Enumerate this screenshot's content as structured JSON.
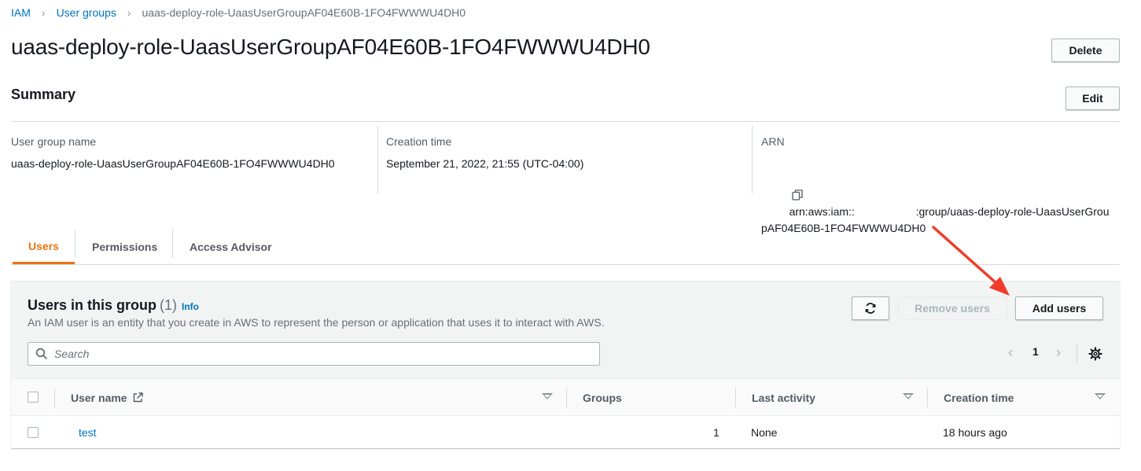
{
  "breadcrumb": {
    "items": [
      "IAM",
      "User groups",
      "uaas-deploy-role-UaasUserGroupAF04E60B-1FO4FWWWU4DH0"
    ]
  },
  "page": {
    "title": "uaas-deploy-role-UaasUserGroupAF04E60B-1FO4FWWWU4DH0",
    "delete_label": "Delete"
  },
  "summary": {
    "title": "Summary",
    "edit_label": "Edit",
    "group_name_label": "User group name",
    "group_name_value": "uaas-deploy-role-UaasUserGroupAF04E60B-1FO4FWWWU4DH0",
    "creation_label": "Creation time",
    "creation_value": "September 21, 2022, 21:55 (UTC-04:00)",
    "arn_label": "ARN",
    "arn_line1": "arn:aws:iam::                    :group/uaas-deploy-role-UaasUserGrou",
    "arn_line2": "pAF04E60B-1FO4FWWWU4DH0"
  },
  "tabs": [
    {
      "label": "Users",
      "active": true
    },
    {
      "label": "Permissions",
      "active": false
    },
    {
      "label": "Access Advisor",
      "active": false
    }
  ],
  "users_panel": {
    "title": "Users in this group",
    "count": "(1)",
    "info_label": "Info",
    "description": "An IAM user is an entity that you create in AWS to represent the person or application that uses it to interact with AWS.",
    "remove_label": "Remove users",
    "add_label": "Add users",
    "search_placeholder": "Search",
    "page_number": "1",
    "columns": [
      "User name",
      "Groups",
      "Last activity",
      "Creation time"
    ],
    "rows": [
      {
        "user_name": "test",
        "groups": "1",
        "last_activity": "None",
        "creation_time": "18 hours ago"
      }
    ]
  },
  "colors": {
    "link": "#0073bb",
    "active_tab": "#ec7211",
    "annotation_arrow": "#f03c28"
  },
  "icons": [
    "chevron-right-icon",
    "copy-icon",
    "refresh-icon",
    "search-icon",
    "chevron-left-icon",
    "gear-icon",
    "external-link-icon",
    "caret-down-icon"
  ]
}
